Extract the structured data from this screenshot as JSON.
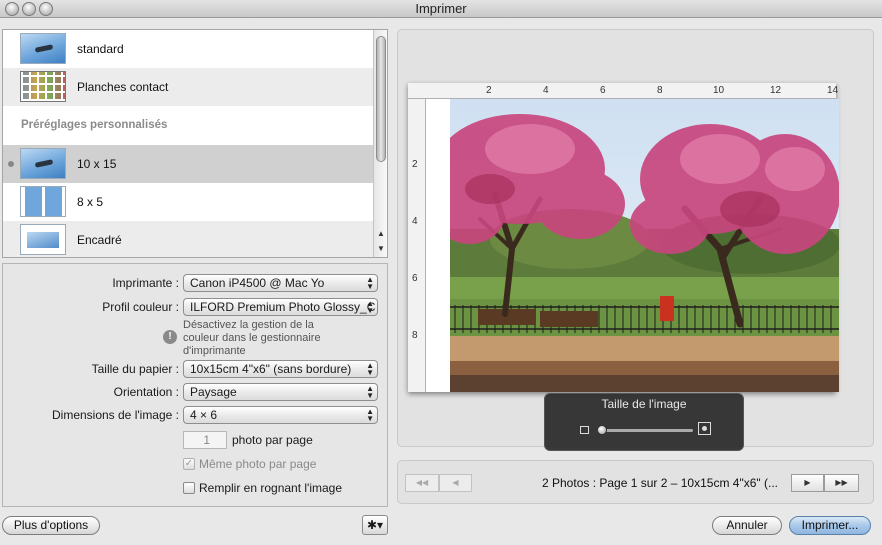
{
  "window": {
    "title": "Imprimer"
  },
  "presets": [
    {
      "label": "standard",
      "thumb": "airplane-photo"
    },
    {
      "label": "Planches contact",
      "thumb": "contact-sheet"
    }
  ],
  "custom_group": {
    "header": "Préréglages personnalisés",
    "items": [
      {
        "label": "10 x 15",
        "thumb": "airplane-photo",
        "selected": true
      },
      {
        "label": "8 x 5",
        "thumb": "two-up-photos"
      },
      {
        "label": "Encadré",
        "thumb": "framed-photo"
      }
    ]
  },
  "form": {
    "printer": {
      "label": "Imprimante :",
      "value": "Canon iP4500 @ Mac Yo"
    },
    "color_profile": {
      "label": "Profil couleur :",
      "value": "ILFORD Premium Photo Glossy_C"
    },
    "warning": "Désactivez la gestion de la couleur dans le gestionnaire d'imprimante",
    "paper_size": {
      "label": "Taille du papier :",
      "value": "10x15cm 4\"x6\" (sans bordure)"
    },
    "orientation": {
      "label": "Orientation :",
      "value": "Paysage"
    },
    "image_dimensions": {
      "label": "Dimensions de l'image :",
      "value": "4 × 6"
    },
    "photos_per_page": {
      "value": "1",
      "label": "photo par page"
    },
    "same_photo_per_page": {
      "label": "Même photo par page",
      "checked": true,
      "disabled": true
    },
    "fill_crop": {
      "label": "Remplir en rognant l'image",
      "checked": false
    }
  },
  "buttons": {
    "more_options": "Plus d'options",
    "cancel": "Annuler",
    "print": "Imprimer..."
  },
  "preview": {
    "ruler_top": [
      "2",
      "4",
      "6",
      "8",
      "10",
      "12",
      "14"
    ],
    "ruler_left": [
      "2",
      "4",
      "6",
      "8"
    ],
    "image_size_hud": {
      "title": "Taille de l'image",
      "level": 0.05
    }
  },
  "pagination": {
    "info": "2 Photos : Page 1 sur 2 – 10x15cm 4\"x6\" (...",
    "first": "◀◀",
    "prev": "◀",
    "next": "▶",
    "last": "▶▶"
  }
}
